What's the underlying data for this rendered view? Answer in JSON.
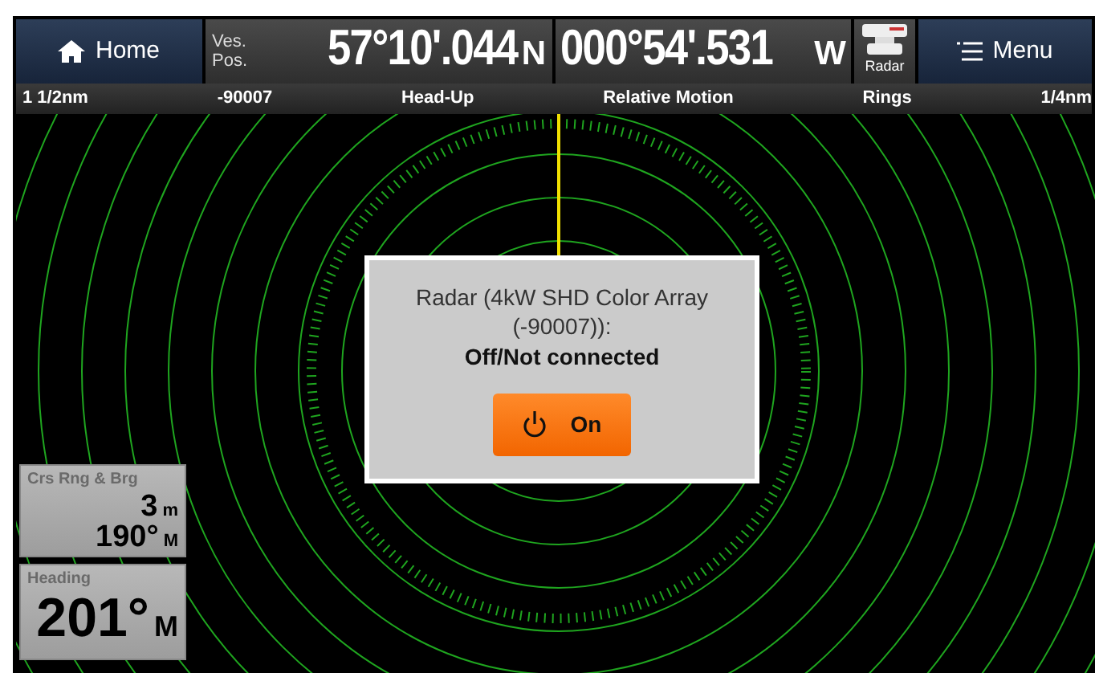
{
  "top_bar": {
    "home": "Home",
    "position_label_lines": [
      "Ves.",
      "Pos."
    ],
    "latitude": {
      "value": "57°10'.044",
      "hemisphere": "N"
    },
    "longitude": {
      "value": "000°54'.531",
      "hemisphere": "W"
    },
    "radar_button": "Radar",
    "menu": "Menu"
  },
  "status_bar": [
    "1 1/2nm",
    "-90007",
    "Head-Up",
    "Relative Motion",
    "Rings",
    "1/4nm"
  ],
  "dialog": {
    "message": "Radar (4kW SHD Color Array (-90007)):",
    "status": "Off/Not connected",
    "button": "On"
  },
  "data_boxes": [
    {
      "title": "Crs Rng & Brg",
      "readings": [
        {
          "value": "3",
          "unit": "m"
        },
        {
          "value": "190°",
          "unit": "M"
        }
      ]
    },
    {
      "title": "Heading",
      "readings": [
        {
          "value": "201°",
          "unit": "M"
        }
      ]
    }
  ]
}
